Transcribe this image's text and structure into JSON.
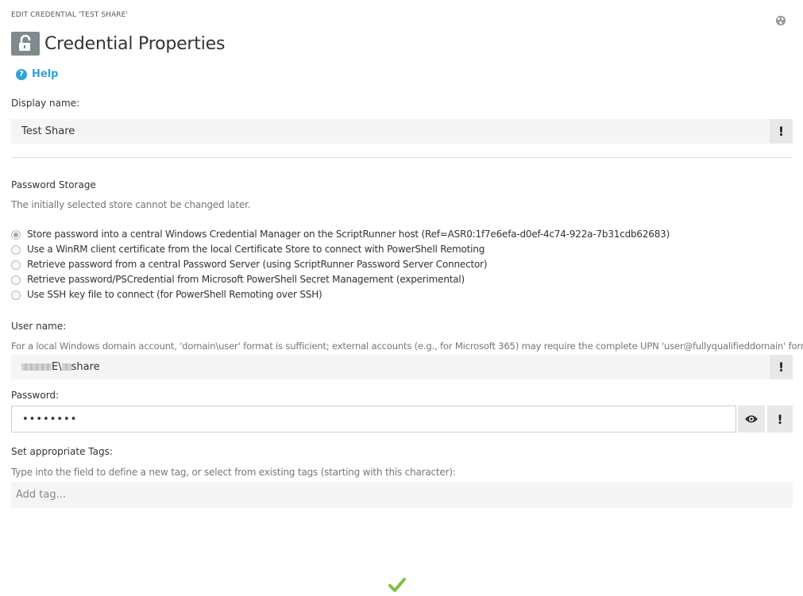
{
  "header": {
    "breadcrumb": "EDIT CREDENTIAL 'TEST SHARE'",
    "title": "Credential Properties",
    "help_label": "Help",
    "help_icon_glyph": "?"
  },
  "display_name": {
    "label": "Display name:",
    "value": "Test Share",
    "required_marker": "!"
  },
  "password_storage": {
    "label": "Password Storage",
    "hint": "The initially selected store cannot be changed later.",
    "options": [
      {
        "label": "Store password into a central Windows Credential Manager on the ScriptRunner host (Ref=ASR0:1f7e6efa-d0ef-4c74-922a-7b31cdb62683)",
        "checked": true
      },
      {
        "label": "Use a WinRM client certificate from the local Certificate Store to connect with PowerShell Remoting",
        "checked": false
      },
      {
        "label": "Retrieve password from a central Password Server (using ScriptRunner Password Server Connector)",
        "checked": false
      },
      {
        "label": "Retrieve password/PSCredential from Microsoft PowerShell Secret Management (experimental)",
        "checked": false
      },
      {
        "label": "Use SSH key file to connect (for PowerShell Remoting over SSH)",
        "checked": false
      }
    ]
  },
  "user_name": {
    "label": "User name:",
    "hint": "For a local Windows domain account, 'domain\\user' format is sufficient; external accounts (e.g., for Microsoft 365) may require the complete UPN 'user@fullyqualifieddomain' format.",
    "value_visible_1": "E\\",
    "value_visible_2": "share",
    "required_marker": "!"
  },
  "password": {
    "label": "Password:",
    "value": "••••••••",
    "required_marker": "!"
  },
  "tags": {
    "label": "Set appropriate Tags:",
    "hint": "Type into the field to define a new tag, or select from existing tags (starting with this character):",
    "placeholder": "Add tag..."
  },
  "colors": {
    "accent": "#2ea3db",
    "confirm": "#7dc242",
    "icon_box": "#808a8c"
  },
  "icons": {
    "globe": "globe-icon",
    "lock": "unlock-icon",
    "help": "question-circle-icon",
    "eye": "eye-icon",
    "save": "check-icon"
  }
}
